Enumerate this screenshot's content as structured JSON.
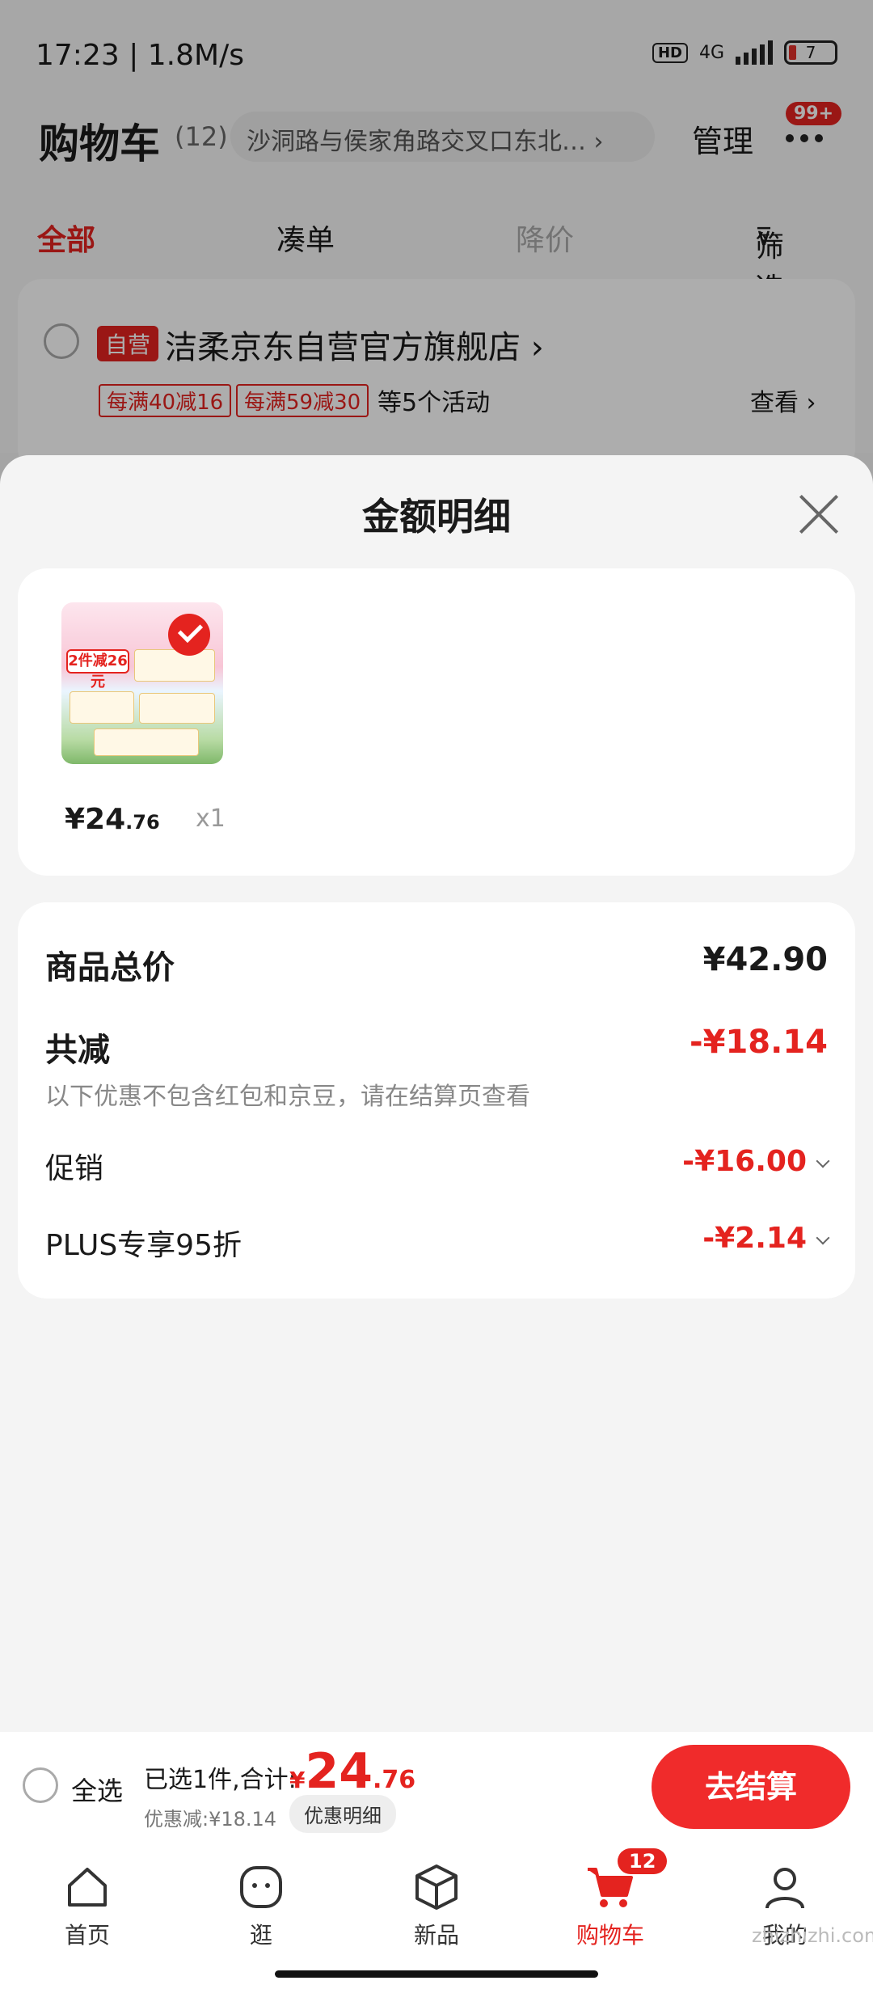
{
  "status": {
    "time": "17:23 | 1.8M/s",
    "hd": "HD",
    "network": "4G",
    "battery": "7"
  },
  "header": {
    "title": "购物车",
    "count": "(12)",
    "address": "沙洞路与侯家角路交叉口东北…",
    "manage": "管理",
    "badge": "99+"
  },
  "tabs": [
    "全部",
    "凑单",
    "降价",
    "筛选"
  ],
  "store": {
    "tag": "自营",
    "name": "洁柔京东自营官方旗舰店",
    "promos": [
      "每满40减16",
      "每满59减30"
    ],
    "activity": "等5个活动",
    "view": "查看"
  },
  "sheet": {
    "title": "金额明细",
    "product": {
      "thumb_tag": "2件减26元",
      "price_int": "¥24",
      "price_dec": ".76",
      "qty": "x1"
    },
    "rows": {
      "total_label": "商品总价",
      "total_value": "¥42.90",
      "reduce_label": "共减",
      "reduce_value": "-¥18.14",
      "note": "以下优惠不包含红包和京豆，请在结算页查看",
      "promo_label": "促销",
      "promo_value": "-¥16.00",
      "plus_label": "PLUS专享95折",
      "plus_value": "-¥2.14"
    }
  },
  "checkout": {
    "select_all": "全选",
    "selected": "已选1件,合计:",
    "currency": "¥",
    "total_int": "24",
    "total_dec": ".76",
    "discount": "优惠减:¥18.14",
    "detail_btn": "优惠明细",
    "pay": "去结算"
  },
  "tabbar": {
    "items": [
      "首页",
      "逛",
      "新品",
      "购物车",
      "我的"
    ],
    "cart_badge": "12"
  },
  "watermark": "zhizhizhi.com",
  "colors": {
    "accent": "#e4231f"
  }
}
